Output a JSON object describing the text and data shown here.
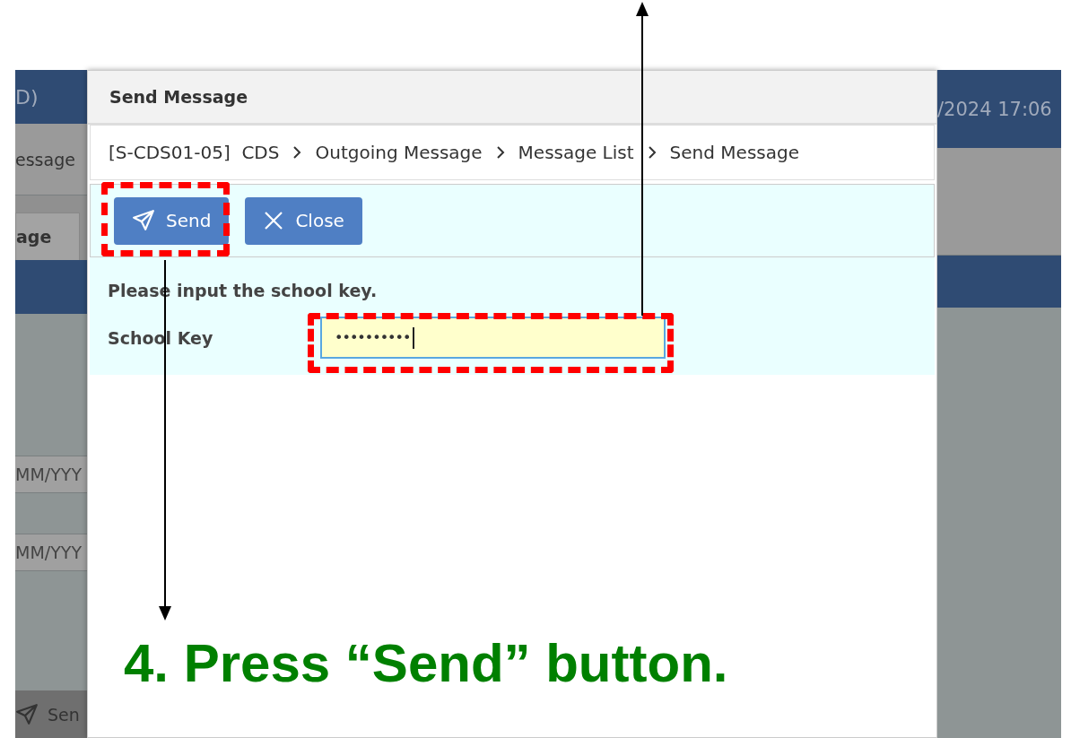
{
  "background_app": {
    "left": {
      "header_text": "D)",
      "menu_text": "essage",
      "tab_label": "age",
      "date_fields": [
        "MM/YYY",
        "MM/YYY"
      ],
      "button_label": "Sen"
    },
    "right": {
      "header_text": "/2024 17:06"
    }
  },
  "dialog": {
    "title": "Send Message",
    "breadcrumb": [
      "[S-CDS01-05]  CDS",
      "Outgoing Message",
      "Message List",
      "Send Message"
    ],
    "buttons": [
      {
        "kind": "send",
        "label": "Send"
      },
      {
        "kind": "close",
        "label": "Close"
      }
    ],
    "prompt": "Please input the school key.",
    "field": {
      "label": "School Key",
      "value": "••••••••••"
    }
  },
  "annotation": {
    "instruction": "4. Press “Send” button."
  }
}
